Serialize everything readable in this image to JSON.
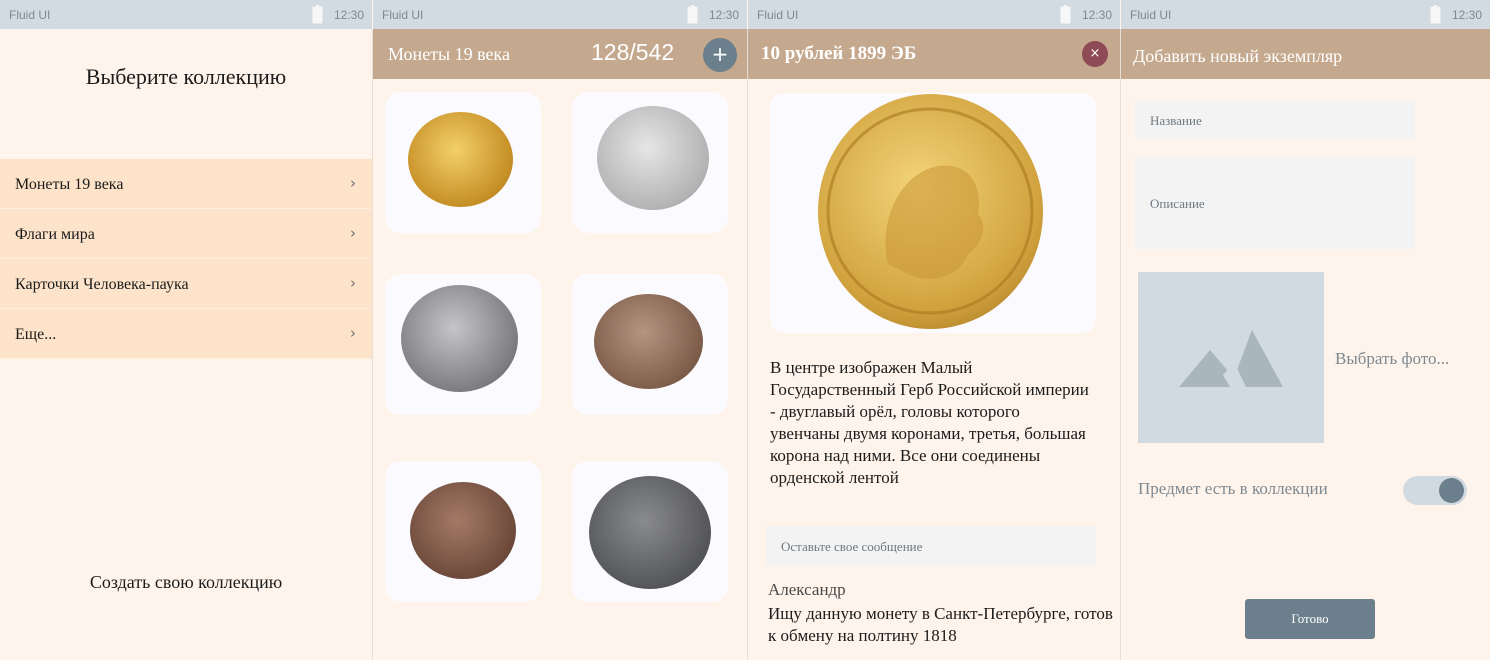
{
  "status": {
    "app": "Fluid UI",
    "time": "12:30"
  },
  "collections": {
    "title": "Выберите коллекцию",
    "items": [
      {
        "label": "Монеты 19 века"
      },
      {
        "label": "Флаги мира"
      },
      {
        "label": "Карточки Человека-паука"
      },
      {
        "label": "Еще..."
      }
    ],
    "chevron": "›",
    "create": "Создать свою коллекцию"
  },
  "coins_list": {
    "title": "Монеты 19 века",
    "count": "128/542",
    "add": "+",
    "coins": [
      {
        "name": "gold-nicholas-coin",
        "color": "#d9a73d"
      },
      {
        "name": "silver-crown-coin",
        "color": "#bdbdbd"
      },
      {
        "name": "silver-wreath-coin",
        "color": "#8c8c8e"
      },
      {
        "name": "copper-wreath-coin",
        "color": "#8c6a55"
      },
      {
        "name": "copper-wreath-coin-2",
        "color": "#7a5645"
      },
      {
        "name": "dark-kopek-coin",
        "color": "#5b5c5f"
      }
    ]
  },
  "detail": {
    "title": "10 рублей 1899 ЭБ",
    "close": "×",
    "description": "В центре изображен Малый Государственный Герб Российской империи - двуглавый орёл, головы которого увенчаны двумя коронами, третья, большая корона над ними. Все они соединены орденской лентой",
    "message_placeholder": "Оставьте свое сообщение",
    "author": "Александр",
    "comment": "Ищу данную монету в Санкт-Петербурге, готов к обмену на полтину 1818"
  },
  "add_item": {
    "title": "Добавить новый экземпляр",
    "name_placeholder": "Название",
    "description_placeholder": "Описание",
    "pick_photo": "Выбрать фото...",
    "in_collection_label": "Предмет есть в коллекции",
    "in_collection": true,
    "done": "Готово"
  },
  "colors": {
    "appbar": "#c5a98e",
    "menu_item": "#fde3c9",
    "accent": "#6c7f8c",
    "close": "#8e4a55"
  }
}
